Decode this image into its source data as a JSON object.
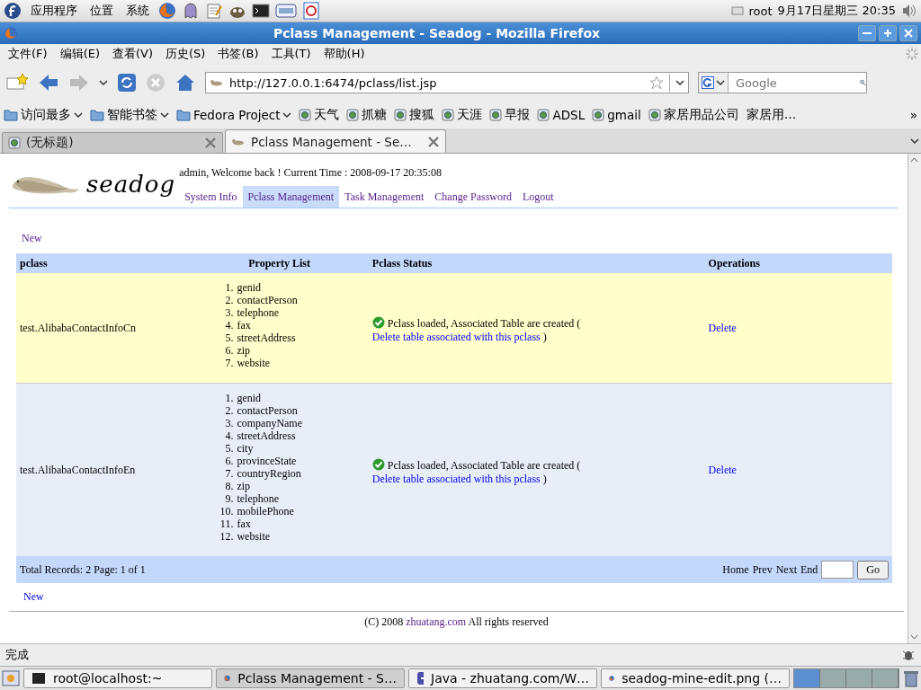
{
  "top_panel": {
    "menus": [
      "应用程序",
      "位置",
      "系统"
    ],
    "user": "root",
    "clock": "9月17日星期三 20:35"
  },
  "window": {
    "title": "Pclass Management - Seadog - Mozilla Firefox"
  },
  "menu_bar": [
    "文件(F)",
    "编辑(E)",
    "查看(V)",
    "历史(S)",
    "书签(B)",
    "工具(T)",
    "帮助(H)"
  ],
  "address": {
    "url": "http://127.0.0.1:6474/pclass/list.jsp"
  },
  "search": {
    "placeholder": "Google"
  },
  "bookmarks": [
    {
      "label": "访问最多",
      "kind": "menu"
    },
    {
      "label": "智能书签",
      "kind": "menu"
    },
    {
      "label": "Fedora Project",
      "kind": "menu"
    },
    {
      "label": "天气",
      "kind": "site"
    },
    {
      "label": "抓糖",
      "kind": "site"
    },
    {
      "label": "搜狐",
      "kind": "site"
    },
    {
      "label": "天涯",
      "kind": "site"
    },
    {
      "label": "早报",
      "kind": "site"
    },
    {
      "label": "ADSL",
      "kind": "site"
    },
    {
      "label": "gmail",
      "kind": "site"
    },
    {
      "label": "家居用品公司",
      "kind": "site"
    },
    {
      "label": "家居用…",
      "kind": "text"
    }
  ],
  "bookmarks_more": "»",
  "tabs": [
    {
      "label": "(无标题)",
      "selected": false
    },
    {
      "label": "Pclass Management - Se…",
      "selected": true
    }
  ],
  "page": {
    "logo": "seadog",
    "user_line": "admin, Welcome back ! Current Time : 2008-09-17 20:35:08",
    "nav": [
      {
        "label": "System Info",
        "selected": false
      },
      {
        "label": "Pclass Management",
        "selected": true
      },
      {
        "label": "Task Management",
        "selected": false
      },
      {
        "label": "Change Password",
        "selected": false
      },
      {
        "label": "Logout",
        "selected": false
      }
    ],
    "new_top": "New",
    "table": {
      "columns": [
        "pclass",
        "Property List",
        "Pclass Status",
        "Operations"
      ],
      "rows": [
        {
          "pclass": "test.AlibabaContactInfoCn",
          "properties": [
            {
              "number": "1.",
              "name": "genid"
            },
            {
              "number": "2.",
              "name": "contactPerson"
            },
            {
              "number": "3.",
              "name": "telephone"
            },
            {
              "number": "4.",
              "name": "fax"
            },
            {
              "number": "5.",
              "name": "streetAddress"
            },
            {
              "number": "6.",
              "name": "zip"
            },
            {
              "number": "7.",
              "name": "website"
            }
          ],
          "status": "Pclass loaded, Associated Table are created (",
          "status_link": "Delete table associated with this pclass",
          "status_end": ")",
          "operation": "Delete"
        },
        {
          "pclass": "test.AlibabaContactInfoEn",
          "properties": [
            {
              "number": "1.",
              "name": "genid"
            },
            {
              "number": "2.",
              "name": "contactPerson"
            },
            {
              "number": "3.",
              "name": "companyName"
            },
            {
              "number": "4.",
              "name": "streetAddress"
            },
            {
              "number": "5.",
              "name": "city"
            },
            {
              "number": "6.",
              "name": "provinceState"
            },
            {
              "number": "7.",
              "name": "countryRegion"
            },
            {
              "number": "8.",
              "name": "zip"
            },
            {
              "number": "9.",
              "name": "telephone"
            },
            {
              "number": "10.",
              "name": "mobilePhone"
            },
            {
              "number": "11.",
              "name": "fax"
            },
            {
              "number": "12.",
              "name": "website"
            }
          ],
          "status": "Pclass loaded, Associated Table are created (",
          "status_link": "Delete table associated with this pclass",
          "status_end": ")",
          "operation": "Delete"
        }
      ]
    },
    "pager": {
      "summary": "Total Records: 2 Page: 1 of 1",
      "links": [
        "Home",
        "Prev",
        "Next",
        "End"
      ],
      "go": "Go"
    },
    "new_bottom": "New",
    "footer": {
      "prefix": "(C) 2008",
      "link": "zhuatang.com",
      "suffix": "All rights reserved"
    }
  },
  "status_bar": "完成",
  "taskbar": [
    {
      "label": "root@localhost:~",
      "selected": false
    },
    {
      "label": "Pclass Management - S…",
      "selected": true
    },
    {
      "label": "Java - zhuatang.com/W…",
      "selected": false
    },
    {
      "label": "seadog-mine-edit.png (…",
      "selected": false
    }
  ],
  "workspaces": [
    {
      "selected": true
    },
    {
      "selected": false
    },
    {
      "selected": false
    },
    {
      "selected": false
    }
  ]
}
